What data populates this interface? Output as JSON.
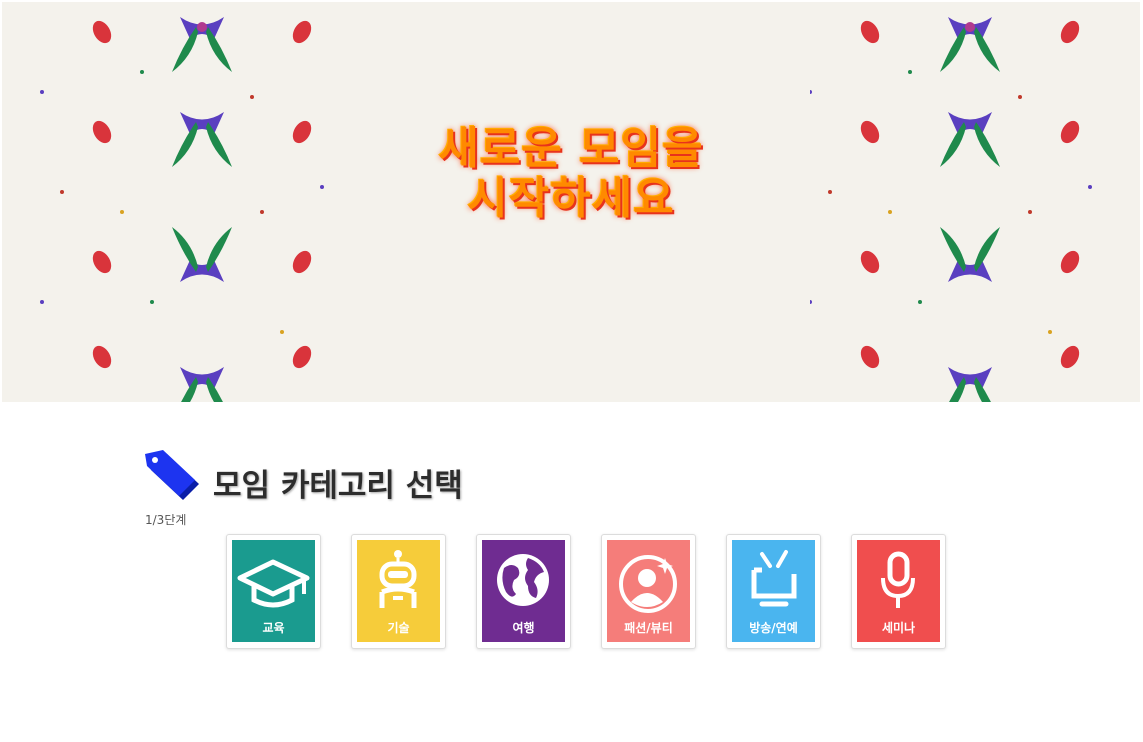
{
  "hero": {
    "title_line1": "새로운 모임을",
    "title_line2": "시작하세요",
    "background_color": "#f4f2ec"
  },
  "section": {
    "icon": "tag-icon",
    "title": "모임 카테고리 선택",
    "step": "1/3단계"
  },
  "categories": [
    {
      "label": "교육",
      "icon": "graduation-cap-icon",
      "color": "#1a9b8f"
    },
    {
      "label": "기술",
      "icon": "robot-icon",
      "color": "#f6cc3a"
    },
    {
      "label": "여행",
      "icon": "globe-icon",
      "color": "#6f2c91"
    },
    {
      "label": "패션/뷰티",
      "icon": "person-sparkle-icon",
      "color": "#f57d7a"
    },
    {
      "label": "방송/연예",
      "icon": "tv-icon",
      "color": "#4ab5ef"
    },
    {
      "label": "세미나",
      "icon": "microphone-icon",
      "color": "#f04e4e"
    }
  ]
}
